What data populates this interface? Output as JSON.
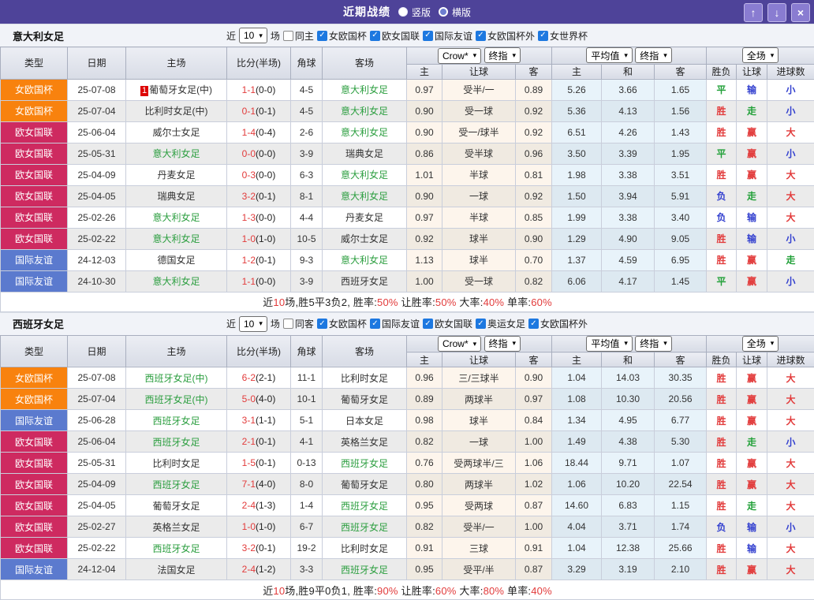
{
  "titlebar": {
    "title": "近期战绩",
    "layout_options": [
      {
        "label": "竖版",
        "selected": true
      },
      {
        "label": "横版",
        "selected": false
      }
    ],
    "buttons": {
      "up": "↑",
      "down": "↓",
      "close": "×"
    }
  },
  "table_header": {
    "type": "类型",
    "date": "日期",
    "home": "主场",
    "score": "比分(半场)",
    "corner": "角球",
    "away": "客场",
    "crow": "Crow*",
    "final": "终指",
    "avg": "平均值",
    "full": "全场",
    "h": "主",
    "handicap": "让球",
    "a": "客",
    "h2": "主",
    "draw": "和",
    "a2": "客",
    "result": "胜负",
    "handicap2": "让球",
    "goals": "进球数"
  },
  "colors": {
    "league": {
      "女欧国杯": "#f8820e",
      "欧女国联": "#ce2a60",
      "国际友谊": "#5b7ace"
    },
    "result": {
      "胜": "#e23b3b",
      "赢": "#e23b3b",
      "大": "#e23b3b",
      "平": "#21a038",
      "走": "#21a038",
      "负": "#3340cf",
      "输": "#3340cf",
      "小": "#3340cf"
    },
    "team_highlight": "#2b9e3f",
    "score_red": "#e23b3b",
    "half_dark": "#222222"
  },
  "sections": [
    {
      "team": "意大利女足",
      "filter": {
        "near": "近",
        "count": "10",
        "unit": "场",
        "same": "同主",
        "same_checked": false,
        "leagues": [
          {
            "label": "女欧国杯",
            "checked": true
          },
          {
            "label": "欧女国联",
            "checked": true
          },
          {
            "label": "国际友谊",
            "checked": true
          },
          {
            "label": "女欧国杯外",
            "checked": true
          },
          {
            "label": "女世界杯",
            "checked": true
          }
        ]
      },
      "rows": [
        {
          "league": "女欧国杯",
          "date": "25-07-08",
          "home": "葡萄牙女足(中)",
          "badge": "1",
          "home_hl": false,
          "score": "1-1",
          "half": "(0-0)",
          "corner": "4-5",
          "away": "意大利女足",
          "away_hl": true,
          "crow": [
            "0.97",
            "受半/一",
            "0.89"
          ],
          "avg": [
            "5.26",
            "3.66",
            "1.65"
          ],
          "res": [
            "平",
            "输",
            "小"
          ]
        },
        {
          "league": "女欧国杯",
          "date": "25-07-04",
          "home": "比利时女足(中)",
          "badge": "",
          "home_hl": false,
          "score": "0-1",
          "half": "(0-1)",
          "corner": "4-5",
          "away": "意大利女足",
          "away_hl": true,
          "crow": [
            "0.90",
            "受一球",
            "0.92"
          ],
          "avg": [
            "5.36",
            "4.13",
            "1.56"
          ],
          "res": [
            "胜",
            "走",
            "小"
          ]
        },
        {
          "league": "欧女国联",
          "date": "25-06-04",
          "home": "威尔士女足",
          "badge": "",
          "home_hl": false,
          "score": "1-4",
          "half": "(0-4)",
          "corner": "2-6",
          "away": "意大利女足",
          "away_hl": true,
          "crow": [
            "0.90",
            "受一/球半",
            "0.92"
          ],
          "avg": [
            "6.51",
            "4.26",
            "1.43"
          ],
          "res": [
            "胜",
            "赢",
            "大"
          ]
        },
        {
          "league": "欧女国联",
          "date": "25-05-31",
          "home": "意大利女足",
          "badge": "",
          "home_hl": true,
          "score": "0-0",
          "half": "(0-0)",
          "corner": "3-9",
          "away": "瑞典女足",
          "away_hl": false,
          "crow": [
            "0.86",
            "受半球",
            "0.96"
          ],
          "avg": [
            "3.50",
            "3.39",
            "1.95"
          ],
          "res": [
            "平",
            "赢",
            "小"
          ]
        },
        {
          "league": "欧女国联",
          "date": "25-04-09",
          "home": "丹麦女足",
          "badge": "",
          "home_hl": false,
          "score": "0-3",
          "half": "(0-0)",
          "corner": "6-3",
          "away": "意大利女足",
          "away_hl": true,
          "crow": [
            "1.01",
            "半球",
            "0.81"
          ],
          "avg": [
            "1.98",
            "3.38",
            "3.51"
          ],
          "res": [
            "胜",
            "赢",
            "大"
          ]
        },
        {
          "league": "欧女国联",
          "date": "25-04-05",
          "home": "瑞典女足",
          "badge": "",
          "home_hl": false,
          "score": "3-2",
          "half": "(0-1)",
          "corner": "8-1",
          "away": "意大利女足",
          "away_hl": true,
          "crow": [
            "0.90",
            "一球",
            "0.92"
          ],
          "avg": [
            "1.50",
            "3.94",
            "5.91"
          ],
          "res": [
            "负",
            "走",
            "大"
          ]
        },
        {
          "league": "欧女国联",
          "date": "25-02-26",
          "home": "意大利女足",
          "badge": "",
          "home_hl": true,
          "score": "1-3",
          "half": "(0-0)",
          "corner": "4-4",
          "away": "丹麦女足",
          "away_hl": false,
          "crow": [
            "0.97",
            "半球",
            "0.85"
          ],
          "avg": [
            "1.99",
            "3.38",
            "3.40"
          ],
          "res": [
            "负",
            "输",
            "大"
          ]
        },
        {
          "league": "欧女国联",
          "date": "25-02-22",
          "home": "意大利女足",
          "badge": "",
          "home_hl": true,
          "score": "1-0",
          "half": "(1-0)",
          "corner": "10-5",
          "away": "威尔士女足",
          "away_hl": false,
          "crow": [
            "0.92",
            "球半",
            "0.90"
          ],
          "avg": [
            "1.29",
            "4.90",
            "9.05"
          ],
          "res": [
            "胜",
            "输",
            "小"
          ]
        },
        {
          "league": "国际友谊",
          "date": "24-12-03",
          "home": "德国女足",
          "badge": "",
          "home_hl": false,
          "score": "1-2",
          "half": "(0-1)",
          "corner": "9-3",
          "away": "意大利女足",
          "away_hl": true,
          "crow": [
            "1.13",
            "球半",
            "0.70"
          ],
          "avg": [
            "1.37",
            "4.59",
            "6.95"
          ],
          "res": [
            "胜",
            "赢",
            "走"
          ]
        },
        {
          "league": "国际友谊",
          "date": "24-10-30",
          "home": "意大利女足",
          "badge": "",
          "home_hl": true,
          "score": "1-1",
          "half": "(0-0)",
          "corner": "3-9",
          "away": "西班牙女足",
          "away_hl": false,
          "crow": [
            "1.00",
            "受一球",
            "0.82"
          ],
          "avg": [
            "6.06",
            "4.17",
            "1.45"
          ],
          "res": [
            "平",
            "赢",
            "小"
          ]
        }
      ],
      "summary": [
        {
          "t": "近"
        },
        {
          "t": "10",
          "r": true
        },
        {
          "t": "场,胜5平3负2, 胜率:"
        },
        {
          "t": "50%",
          "r": true
        },
        {
          "t": " 让胜率:"
        },
        {
          "t": "50%",
          "r": true
        },
        {
          "t": " 大率:"
        },
        {
          "t": "40%",
          "r": true
        },
        {
          "t": " 单率:"
        },
        {
          "t": "60%",
          "r": true
        }
      ]
    },
    {
      "team": "西班牙女足",
      "filter": {
        "near": "近",
        "count": "10",
        "unit": "场",
        "same": "同客",
        "same_checked": false,
        "leagues": [
          {
            "label": "女欧国杯",
            "checked": true
          },
          {
            "label": "国际友谊",
            "checked": true
          },
          {
            "label": "欧女国联",
            "checked": true
          },
          {
            "label": "奥运女足",
            "checked": true
          },
          {
            "label": "女欧国杯外",
            "checked": true
          }
        ]
      },
      "rows": [
        {
          "league": "女欧国杯",
          "date": "25-07-08",
          "home": "西班牙女足(中)",
          "badge": "",
          "home_hl": true,
          "score": "6-2",
          "half": "(2-1)",
          "corner": "11-1",
          "away": "比利时女足",
          "away_hl": false,
          "crow": [
            "0.96",
            "三/三球半",
            "0.90"
          ],
          "avg": [
            "1.04",
            "14.03",
            "30.35"
          ],
          "res": [
            "胜",
            "赢",
            "大"
          ]
        },
        {
          "league": "女欧国杯",
          "date": "25-07-04",
          "home": "西班牙女足(中)",
          "badge": "",
          "home_hl": true,
          "score": "5-0",
          "half": "(4-0)",
          "corner": "10-1",
          "away": "葡萄牙女足",
          "away_hl": false,
          "crow": [
            "0.89",
            "两球半",
            "0.97"
          ],
          "avg": [
            "1.08",
            "10.30",
            "20.56"
          ],
          "res": [
            "胜",
            "赢",
            "大"
          ]
        },
        {
          "league": "国际友谊",
          "date": "25-06-28",
          "home": "西班牙女足",
          "badge": "",
          "home_hl": true,
          "score": "3-1",
          "half": "(1-1)",
          "corner": "5-1",
          "away": "日本女足",
          "away_hl": false,
          "crow": [
            "0.98",
            "球半",
            "0.84"
          ],
          "avg": [
            "1.34",
            "4.95",
            "6.77"
          ],
          "res": [
            "胜",
            "赢",
            "大"
          ]
        },
        {
          "league": "欧女国联",
          "date": "25-06-04",
          "home": "西班牙女足",
          "badge": "",
          "home_hl": true,
          "score": "2-1",
          "half": "(0-1)",
          "corner": "4-1",
          "away": "英格兰女足",
          "away_hl": false,
          "crow": [
            "0.82",
            "一球",
            "1.00"
          ],
          "avg": [
            "1.49",
            "4.38",
            "5.30"
          ],
          "res": [
            "胜",
            "走",
            "小"
          ]
        },
        {
          "league": "欧女国联",
          "date": "25-05-31",
          "home": "比利时女足",
          "badge": "",
          "home_hl": false,
          "score": "1-5",
          "half": "(0-1)",
          "corner": "0-13",
          "away": "西班牙女足",
          "away_hl": true,
          "crow": [
            "0.76",
            "受两球半/三",
            "1.06"
          ],
          "avg": [
            "18.44",
            "9.71",
            "1.07"
          ],
          "res": [
            "胜",
            "赢",
            "大"
          ]
        },
        {
          "league": "欧女国联",
          "date": "25-04-09",
          "home": "西班牙女足",
          "badge": "",
          "home_hl": true,
          "score": "7-1",
          "half": "(4-0)",
          "corner": "8-0",
          "away": "葡萄牙女足",
          "away_hl": false,
          "crow": [
            "0.80",
            "两球半",
            "1.02"
          ],
          "avg": [
            "1.06",
            "10.20",
            "22.54"
          ],
          "res": [
            "胜",
            "赢",
            "大"
          ]
        },
        {
          "league": "欧女国联",
          "date": "25-04-05",
          "home": "葡萄牙女足",
          "badge": "",
          "home_hl": false,
          "score": "2-4",
          "half": "(1-3)",
          "corner": "1-4",
          "away": "西班牙女足",
          "away_hl": true,
          "crow": [
            "0.95",
            "受两球",
            "0.87"
          ],
          "avg": [
            "14.60",
            "6.83",
            "1.15"
          ],
          "res": [
            "胜",
            "走",
            "大"
          ]
        },
        {
          "league": "欧女国联",
          "date": "25-02-27",
          "home": "英格兰女足",
          "badge": "",
          "home_hl": false,
          "score": "1-0",
          "half": "(1-0)",
          "corner": "6-7",
          "away": "西班牙女足",
          "away_hl": true,
          "crow": [
            "0.82",
            "受半/一",
            "1.00"
          ],
          "avg": [
            "4.04",
            "3.71",
            "1.74"
          ],
          "res": [
            "负",
            "输",
            "小"
          ]
        },
        {
          "league": "欧女国联",
          "date": "25-02-22",
          "home": "西班牙女足",
          "badge": "",
          "home_hl": true,
          "score": "3-2",
          "half": "(0-1)",
          "corner": "19-2",
          "away": "比利时女足",
          "away_hl": false,
          "crow": [
            "0.91",
            "三球",
            "0.91"
          ],
          "avg": [
            "1.04",
            "12.38",
            "25.66"
          ],
          "res": [
            "胜",
            "输",
            "大"
          ]
        },
        {
          "league": "国际友谊",
          "date": "24-12-04",
          "home": "法国女足",
          "badge": "",
          "home_hl": false,
          "score": "2-4",
          "half": "(1-2)",
          "corner": "3-3",
          "away": "西班牙女足",
          "away_hl": true,
          "crow": [
            "0.95",
            "受平/半",
            "0.87"
          ],
          "avg": [
            "3.29",
            "3.19",
            "2.10"
          ],
          "res": [
            "胜",
            "赢",
            "大"
          ]
        }
      ],
      "summary": [
        {
          "t": "近"
        },
        {
          "t": "10",
          "r": true
        },
        {
          "t": "场,胜9平0负1, 胜率:"
        },
        {
          "t": "90%",
          "r": true
        },
        {
          "t": " 让胜率:"
        },
        {
          "t": "60%",
          "r": true
        },
        {
          "t": " 大率:"
        },
        {
          "t": "80%",
          "r": true
        },
        {
          "t": " 单率:"
        },
        {
          "t": "40%",
          "r": true
        }
      ]
    }
  ]
}
